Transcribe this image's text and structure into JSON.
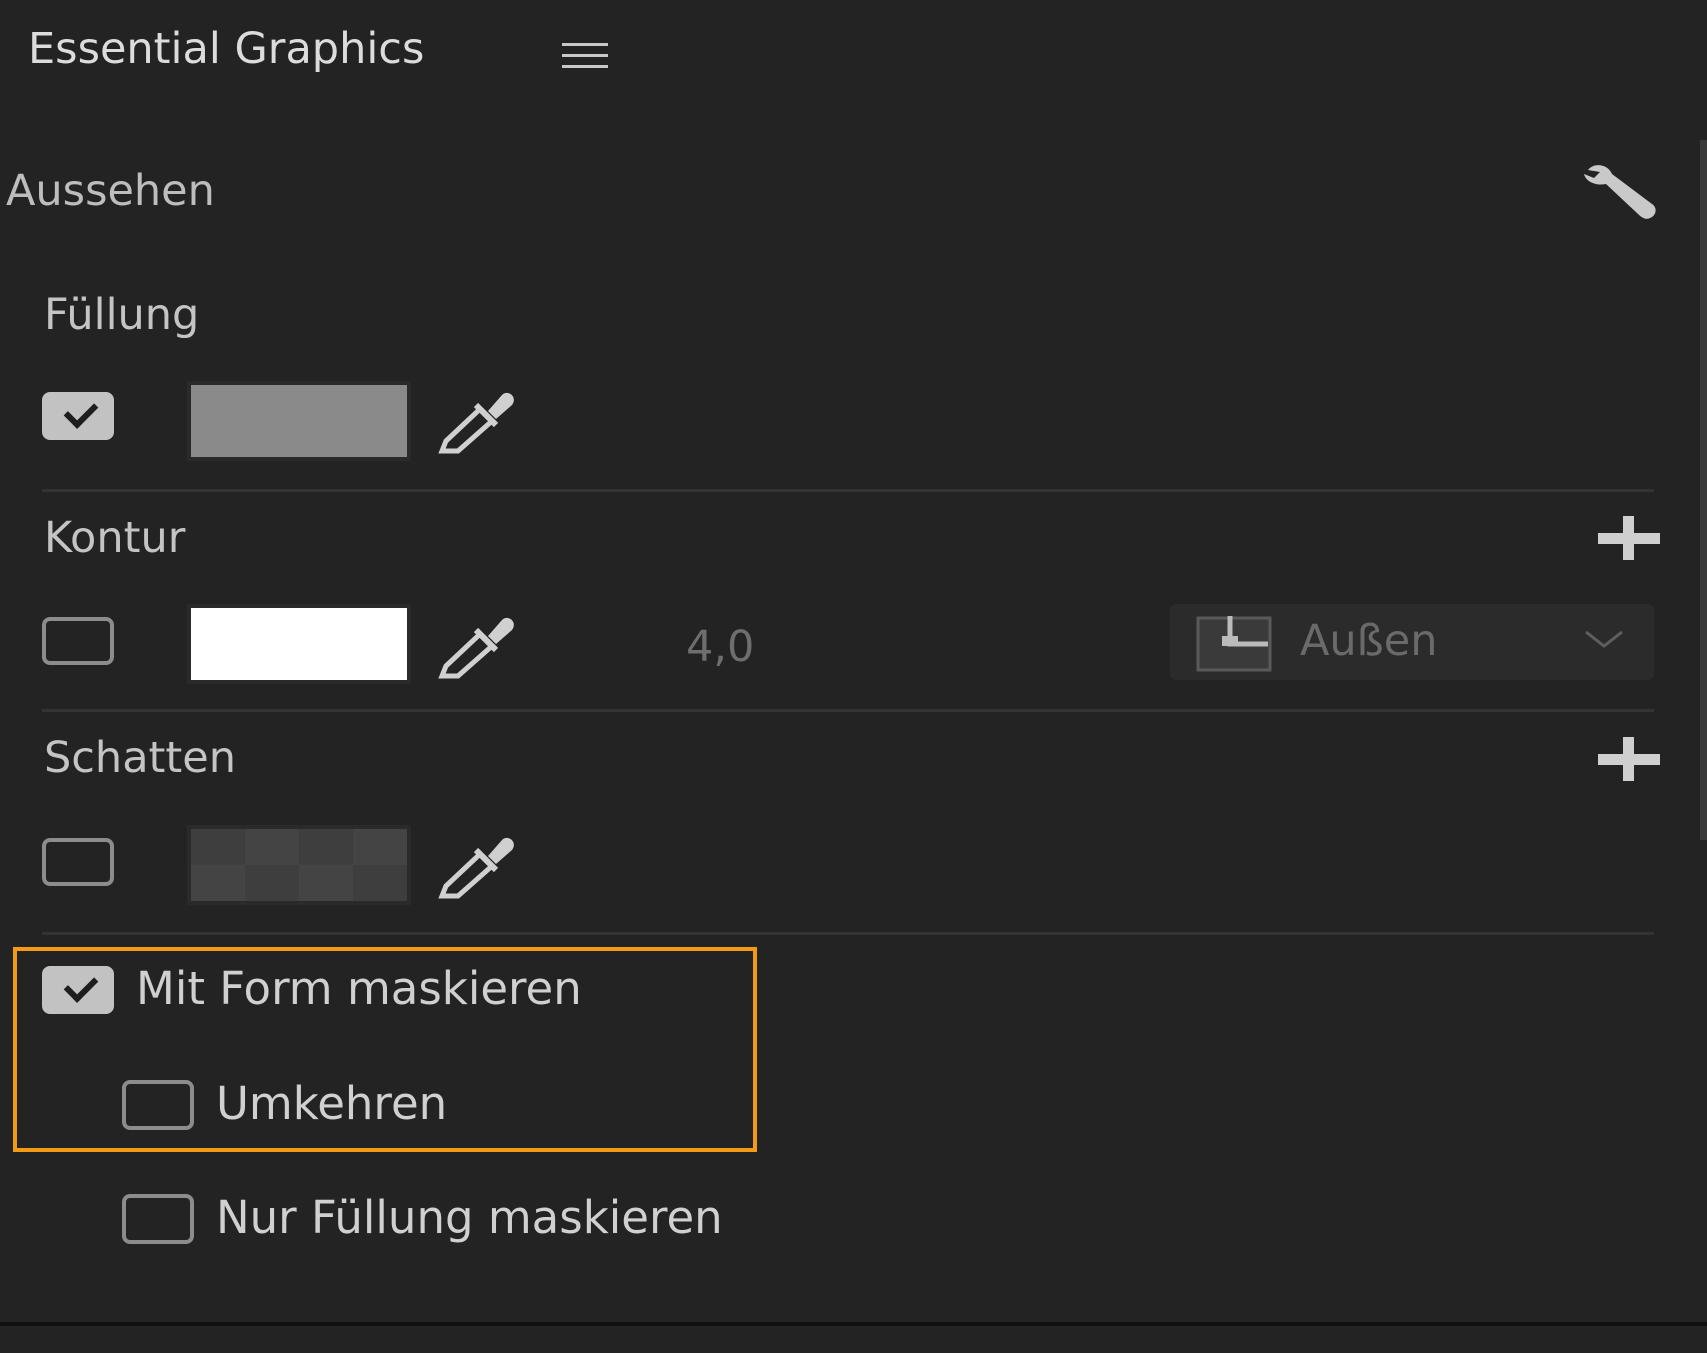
{
  "panel": {
    "title": "Essential Graphics"
  },
  "appearance": {
    "title": "Aussehen"
  },
  "fill": {
    "label": "Füllung",
    "enabled": true,
    "color": "#8a8a8a"
  },
  "stroke": {
    "label": "Kontur",
    "enabled": false,
    "color": "#ffffff",
    "width": "4,0",
    "position": "Außen"
  },
  "shadow": {
    "label": "Schatten",
    "enabled": false,
    "color": "#444444"
  },
  "mask": {
    "with_shape_label": "Mit Form maskieren",
    "with_shape_checked": true,
    "invert_label": "Umkehren",
    "invert_checked": false,
    "fill_only_label": "Nur Füllung maskieren",
    "fill_only_checked": false
  },
  "colors": {
    "highlight": "#f39a17",
    "background": "#232323"
  },
  "icons": [
    "hamburger-menu-icon",
    "wrench-icon",
    "eyedropper-icon",
    "plus-icon",
    "stroke-position-icon",
    "chevron-down-icon"
  ]
}
